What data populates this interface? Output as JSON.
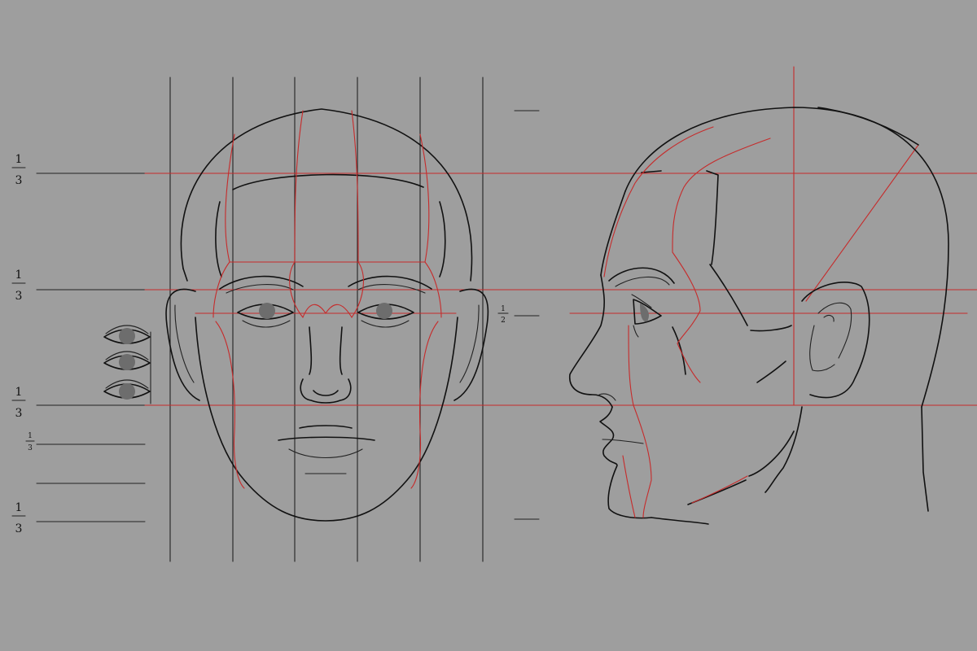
{
  "fractions": {
    "top_third": {
      "num": "1",
      "den": "3"
    },
    "middle_third": {
      "num": "1",
      "den": "3"
    },
    "lower_third": {
      "num": "1",
      "den": "3"
    },
    "mouth_third": {
      "num": "1",
      "den": "3"
    },
    "chin_third": {
      "num": "1",
      "den": "3"
    },
    "side_half": {
      "num": "1",
      "den": "2"
    }
  },
  "colors": {
    "background": "#9e9e9e",
    "construction": "#c62b2b",
    "ink": "#111111",
    "iris": "#6d6d6d"
  }
}
